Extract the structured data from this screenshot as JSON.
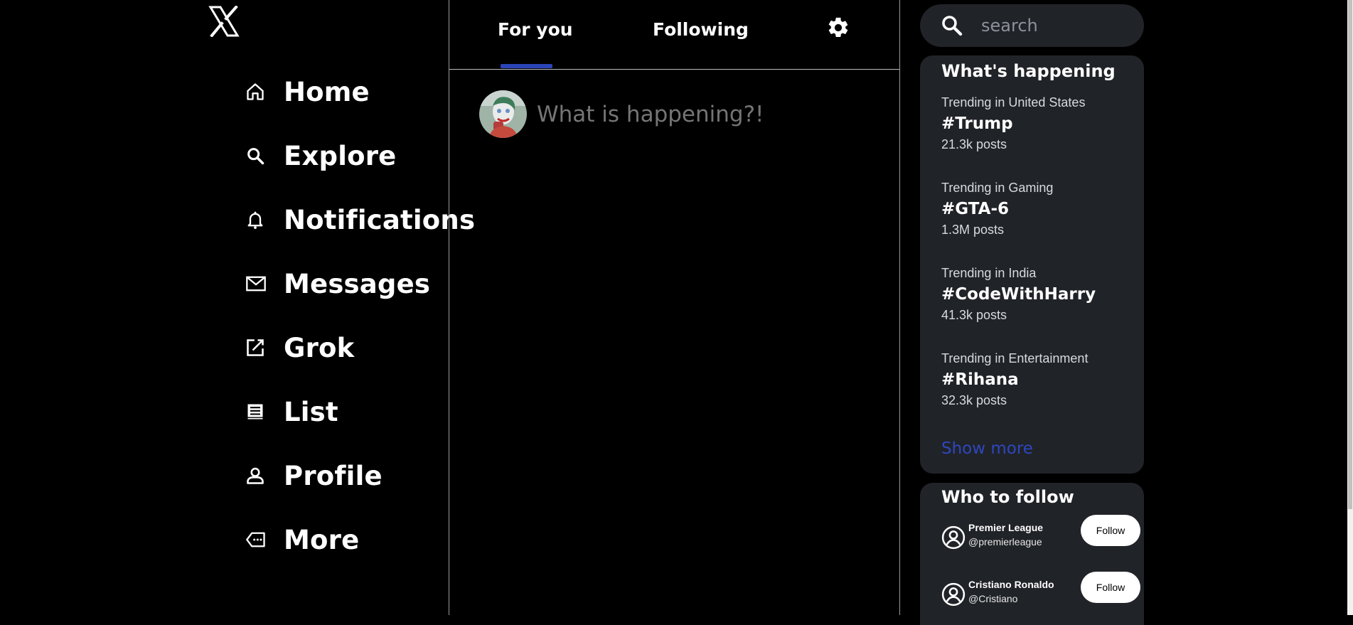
{
  "nav": {
    "logo_icon": "x-logo-icon",
    "items": [
      {
        "label": "Home",
        "icon": "home-icon"
      },
      {
        "label": "Explore",
        "icon": "search-icon"
      },
      {
        "label": "Notifications",
        "icon": "bell-icon"
      },
      {
        "label": "Messages",
        "icon": "mail-icon"
      },
      {
        "label": "Grok",
        "icon": "external-edit-icon"
      },
      {
        "label": "List",
        "icon": "list-icon"
      },
      {
        "label": "Profile",
        "icon": "person-icon"
      },
      {
        "label": "More",
        "icon": "more-tag-icon"
      }
    ]
  },
  "main": {
    "tabs": [
      {
        "label": "For you",
        "active": true
      },
      {
        "label": "Following",
        "active": false
      }
    ],
    "accent": "#2b44b8",
    "composer": {
      "placeholder": "What is happening?!"
    }
  },
  "sidebar": {
    "search": {
      "placeholder": "search"
    },
    "happening": {
      "title": "What's happening",
      "trends": [
        {
          "context": "Trending in United States",
          "tag": "#Trump",
          "count": "21.3k posts"
        },
        {
          "context": "Trending in Gaming",
          "tag": "#GTA-6",
          "count": "1.3M posts"
        },
        {
          "context": "Trending in India",
          "tag": "#CodeWithHarry",
          "count": "41.3k posts"
        },
        {
          "context": "Trending in Entertainment",
          "tag": "#Rihana",
          "count": "32.3k posts"
        }
      ],
      "show_more": "Show more"
    },
    "who_to_follow": {
      "title": "Who to follow",
      "accounts": [
        {
          "name": "Premier League",
          "handle": "@premierleague",
          "button": "Follow"
        },
        {
          "name": "Cristiano Ronaldo",
          "handle": "@Cristiano",
          "button": "Follow"
        }
      ]
    }
  },
  "colors": {
    "background": "#000000",
    "panel": "#202327",
    "link": "#2e47bf"
  }
}
